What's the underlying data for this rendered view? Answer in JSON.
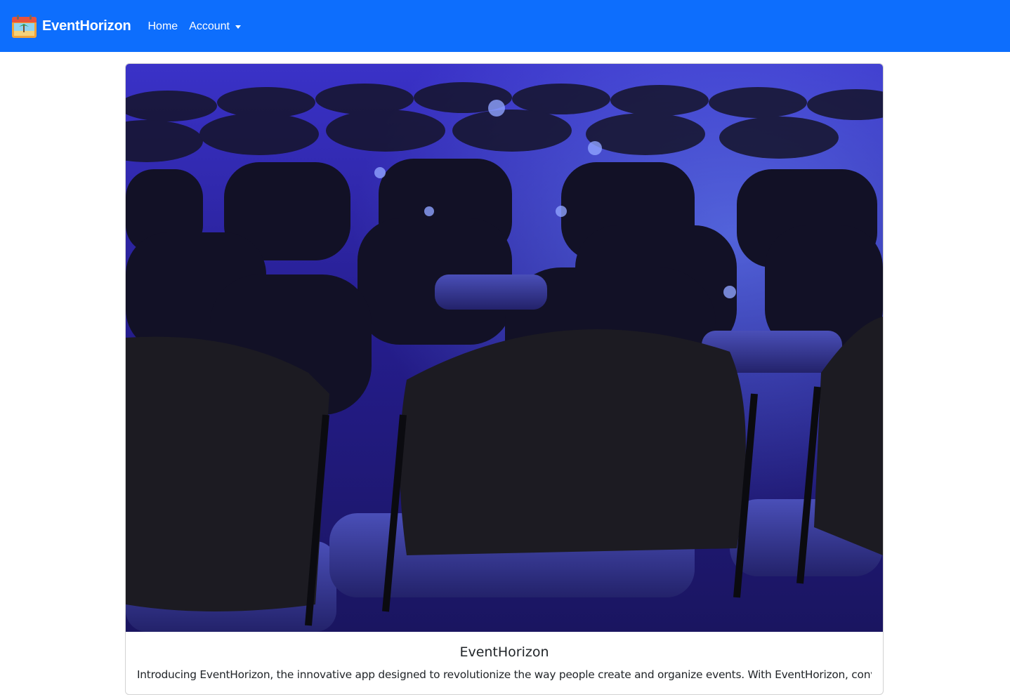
{
  "navbar": {
    "brand": "EventHorizon",
    "brand_logo_icon": "calendar-beach-logo-icon",
    "links": [
      {
        "label": "Home"
      },
      {
        "label": "Account",
        "has_dropdown": true
      }
    ],
    "background": "#0d6efd"
  },
  "card": {
    "image_icon": "conference-chairs-photo",
    "title": "EventHorizon",
    "text": "Introducing EventHorizon, the innovative app designed to revolutionize the way people create and organize events. With EventHorizon, convenience"
  }
}
